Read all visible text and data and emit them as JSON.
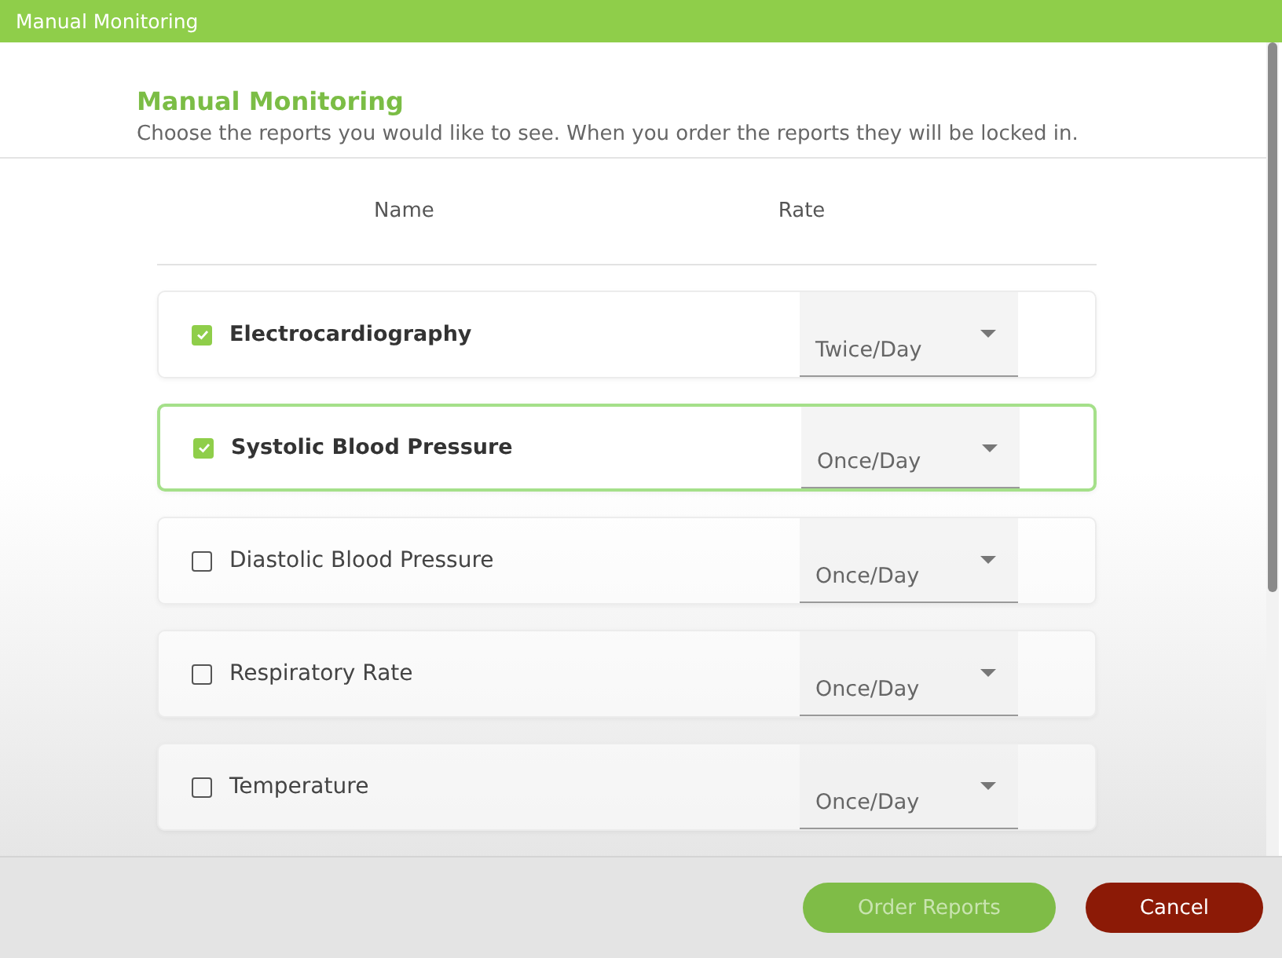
{
  "window": {
    "title": "Manual Monitoring"
  },
  "header": {
    "title": "Manual Monitoring",
    "subtitle": "Choose the reports you would like to see. When you order the reports they will be locked in."
  },
  "table": {
    "columns": [
      "Name",
      "Rate"
    ],
    "rows": [
      {
        "name": "Electrocardiography",
        "checked": true,
        "focused": false,
        "rate": "Twice/Day"
      },
      {
        "name": "Systolic Blood Pressure",
        "checked": true,
        "focused": true,
        "rate": "Once/Day"
      },
      {
        "name": "Diastolic Blood Pressure",
        "checked": false,
        "focused": false,
        "rate": "Once/Day"
      },
      {
        "name": "Respiratory Rate",
        "checked": false,
        "focused": false,
        "rate": "Once/Day"
      },
      {
        "name": "Temperature",
        "checked": false,
        "focused": false,
        "rate": "Once/Day"
      }
    ]
  },
  "buttons": [
    {
      "label": "Order Reports",
      "kind": "primary",
      "disabled": true
    },
    {
      "label": "Cancel",
      "kind": "cancel",
      "disabled": false
    }
  ]
}
